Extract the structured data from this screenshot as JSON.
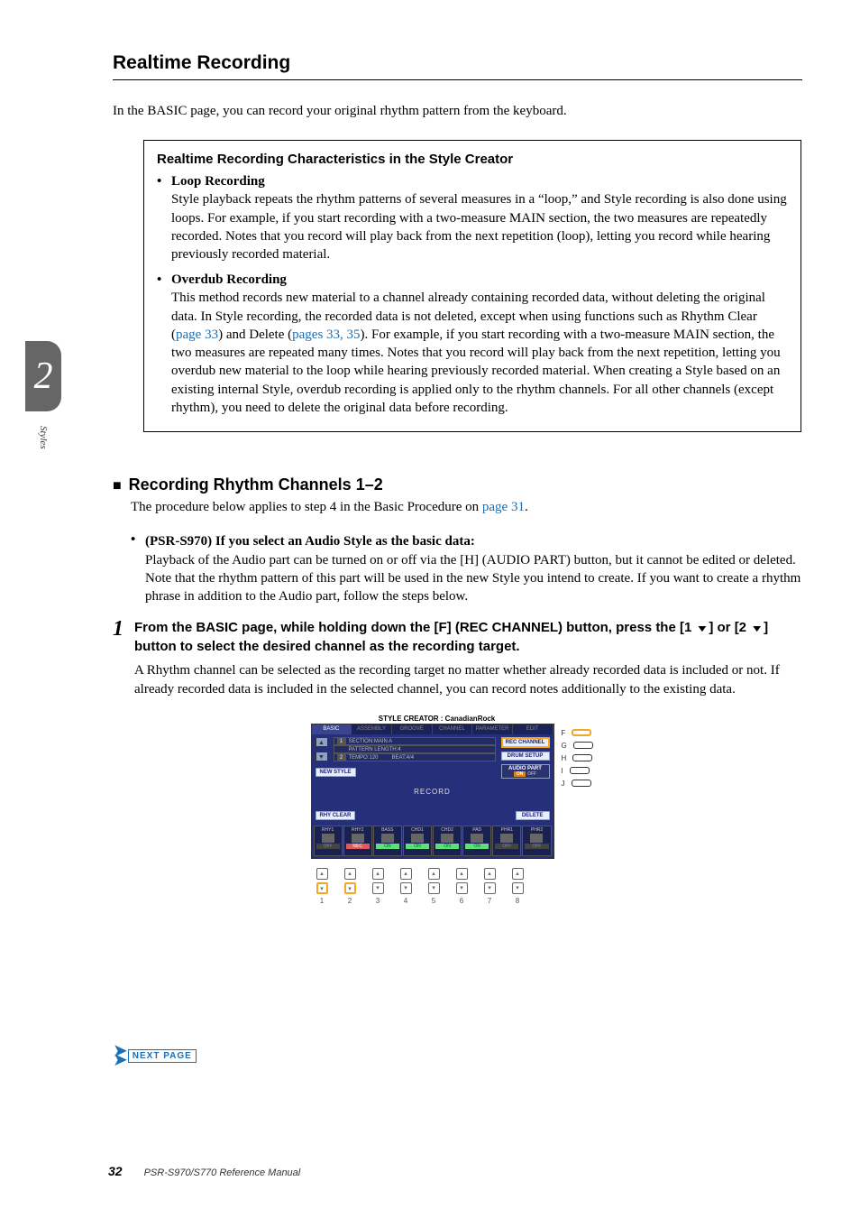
{
  "sidebar": {
    "chapter_number": "2",
    "chapter_label": "Styles"
  },
  "page": {
    "h1": "Realtime Recording",
    "intro": "In the BASIC page, you can record your original rhythm pattern from the keyboard."
  },
  "charbox": {
    "title": "Realtime Recording Characteristics in the Style Creator",
    "loop_head": "Loop Recording",
    "loop_text": "Style playback repeats the rhythm patterns of several measures in a “loop,” and Style recording is also done using loops. For example, if you start recording with a two-measure MAIN section, the two measures are repeatedly recorded. Notes that you record will play back from the next repetition (loop), letting you record while hearing previously recorded material.",
    "over_head": "Overdub Recording",
    "over_text_a": "This method records new material to a channel already containing recorded data, without deleting the original data. In Style recording, the recorded data is not deleted, except when using functions such as Rhythm Clear (",
    "over_link1": "page 33",
    "over_text_b": ") and Delete (",
    "over_link2": "pages 33",
    "over_link2b": ", ",
    "over_link3": "35",
    "over_text_c": "). For example, if you start recording with a two-measure MAIN section, the two measures are repeated many times. Notes that you record will play back from the next repetition, letting you overdub new material to the loop while hearing previously recorded material. When creating a Style based on an existing internal Style, overdub recording is applied only to the rhythm channels. For all other channels (except rhythm), you need to delete the original data before recording."
  },
  "h2": {
    "title": "Recording Rhythm Channels 1–2",
    "after_a": "The procedure below applies to step 4 in the Basic Procedure on ",
    "after_link": "page 31",
    "after_b": "."
  },
  "s970": {
    "head": "(PSR-S970) If you select an Audio Style as the basic data:",
    "text": "Playback of the Audio part can be turned on or off via the [H] (AUDIO PART) button, but it cannot be edited or deleted. Note that the rhythm pattern of this part will be used in the new Style you intend to create. If you want to create a rhythm phrase in addition to the Audio part, follow the steps below."
  },
  "step1": {
    "num": "1",
    "title_a": "From the BASIC page, while holding down the [F] (REC CHANNEL) button, press the [1 ",
    "title_b": "] or [2 ",
    "title_c": "] button to select the desired channel as the recording target.",
    "text": "A Rhythm channel can be selected as the recording target no matter whether already recorded data is included or not. If already recorded data is included in the selected channel, you can record notes additionally to the existing data."
  },
  "figure": {
    "title": "STYLE CREATOR : CanadianRock",
    "tabs": [
      "BASIC",
      "ASSEMBLY",
      "GROOVE",
      "CHANNEL",
      "PARAMETER",
      "EDIT"
    ],
    "info": {
      "section": "SECTION:MAIN A",
      "pattern": "PATTERN LENGTH:4",
      "tempo": "TEMPO:120",
      "beat": "BEAT:4/4"
    },
    "buttons": {
      "newstyle": "NEW STYLE",
      "rec_channel": "REC CHANNEL",
      "drum_setup": "DRUM SETUP",
      "audio_part": "AUDIO PART",
      "audio_on": "ON",
      "audio_off": "OFF",
      "record_center": "RECORD",
      "rhy_clear": "RHY CLEAR",
      "delete": "DELETE"
    },
    "channels": [
      {
        "name": "RHY1",
        "state": "OFF"
      },
      {
        "name": "RHY2",
        "state": "REC"
      },
      {
        "name": "BASS",
        "state": "ON"
      },
      {
        "name": "CHD1",
        "state": "ON"
      },
      {
        "name": "CHD2",
        "state": "ON"
      },
      {
        "name": "PAD",
        "state": "ON"
      },
      {
        "name": "PHR1",
        "state": "OFF"
      },
      {
        "name": "PHR2",
        "state": "OFF"
      }
    ],
    "side_letters": [
      "F",
      "G",
      "H",
      "I",
      "J"
    ],
    "bottom_nums": [
      "1",
      "2",
      "3",
      "4",
      "5",
      "6",
      "7",
      "8"
    ]
  },
  "nextpage": "NEXT PAGE",
  "footer": {
    "page": "32",
    "manual": "PSR-S970/S770 Reference Manual"
  }
}
